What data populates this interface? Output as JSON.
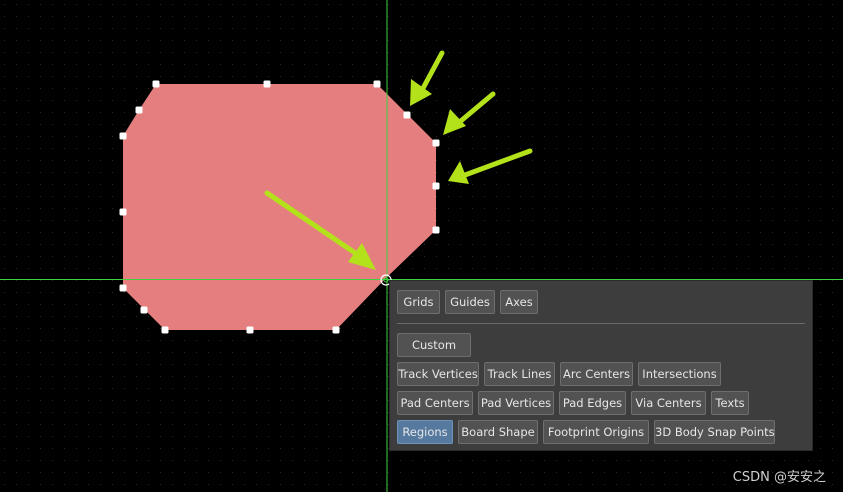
{
  "canvas": {
    "background": "#000000",
    "grid_dot_color": "#2b2b2b",
    "crosshair_color": "#3fd23f",
    "region_fill": "#e57f7f",
    "arrow_color": "#b3e21a",
    "handle_color": "#ffffff"
  },
  "snap_panel": {
    "row1": {
      "grids": "Grids",
      "guides": "Guides",
      "axes": "Axes"
    },
    "custom": "Custom",
    "row3": {
      "track_vertices": "Track Vertices",
      "track_lines": "Track Lines",
      "arc_centers": "Arc Centers",
      "intersections": "Intersections"
    },
    "row4": {
      "pad_centers": "Pad Centers",
      "pad_vertices": "Pad Vertices",
      "pad_edges": "Pad Edges",
      "via_centers": "Via Centers",
      "texts": "Texts"
    },
    "row5": {
      "regions": "Regions",
      "board_shape": "Board Shape",
      "footprint_origins": "Footprint Origins",
      "body_snap_points": "3D Body Snap Points"
    },
    "active": "Regions"
  },
  "watermark": "CSDN @安安之"
}
